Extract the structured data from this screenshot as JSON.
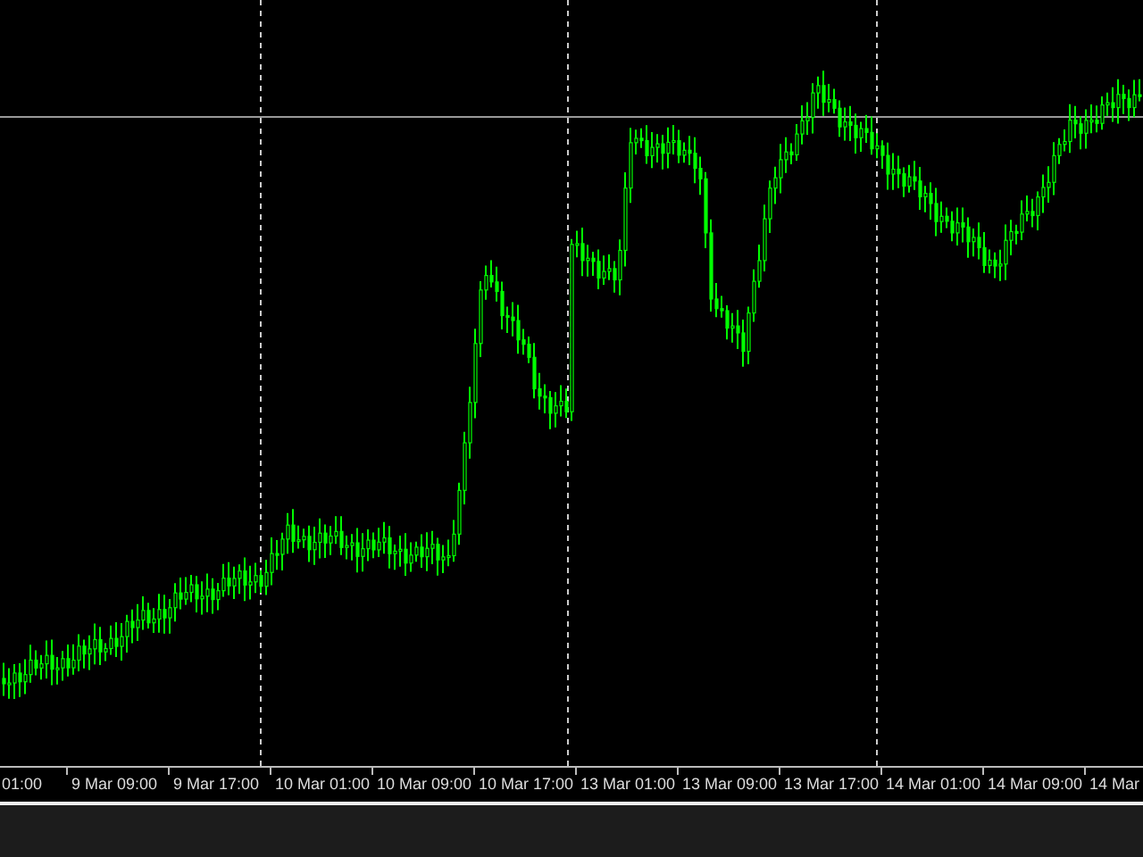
{
  "chart": {
    "time_labels": [
      "01:00",
      "9 Mar 09:00",
      "9 Mar 17:00",
      "10 Mar 01:00",
      "10 Mar 09:00",
      "10 Mar 17:00",
      "13 Mar 01:00",
      "13 Mar 09:00",
      "13 Mar 17:00",
      "14 Mar 01:00",
      "14 Mar 09:00",
      "14 Mar"
    ]
  }
}
